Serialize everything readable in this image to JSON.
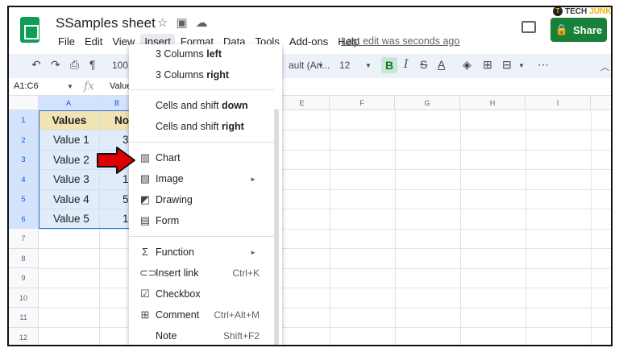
{
  "header": {
    "doc_title": "SSamples sheet",
    "last_edit": "Last edit was seconds ago",
    "share_label": "Share",
    "watermark_a": "TECH",
    "watermark_b": "JUNKIE",
    "menubar": [
      "File",
      "Edit",
      "View",
      "Insert",
      "Format",
      "Data",
      "Tools",
      "Add-ons",
      "Help"
    ]
  },
  "toolbar": {
    "zoom": "100",
    "font": "ault (Ari...",
    "font_size": "12",
    "bold": "B"
  },
  "formula": {
    "name_box": "A1:C6",
    "fx": "fx",
    "value": "Value"
  },
  "grid": {
    "columns": [
      "A",
      "B",
      "E",
      "F",
      "G",
      "H",
      "I"
    ],
    "rows": [
      "1",
      "2",
      "3",
      "4",
      "5",
      "6",
      "7",
      "8",
      "9",
      "10",
      "11",
      "12"
    ],
    "a_header": "Values",
    "b_header": "No",
    "a_values": [
      "Value 1",
      "Value 2",
      "Value 3",
      "Value 4",
      "Value 5"
    ],
    "b_values": [
      "3",
      "",
      "1",
      "5",
      "1"
    ]
  },
  "menu": {
    "cols_left_a": "3 Columns ",
    "cols_left_b": "left",
    "cols_right_a": "3 Columns ",
    "cols_right_b": "right",
    "shift_down_a": "Cells and shift ",
    "shift_down_b": "down",
    "shift_right_a": "Cells and shift ",
    "shift_right_b": "right",
    "chart": "Chart",
    "image": "Image",
    "drawing": "Drawing",
    "form": "Form",
    "function": "Function",
    "insert_link": "Insert link",
    "insert_link_sc": "Ctrl+K",
    "checkbox": "Checkbox",
    "comment": "Comment",
    "comment_sc": "Ctrl+Alt+M",
    "note": "Note",
    "note_sc": "Shift+F2"
  },
  "colors": {
    "share_green": "#188038",
    "arrow_red": "#e00000",
    "selection_blue": "#1a73e8"
  }
}
